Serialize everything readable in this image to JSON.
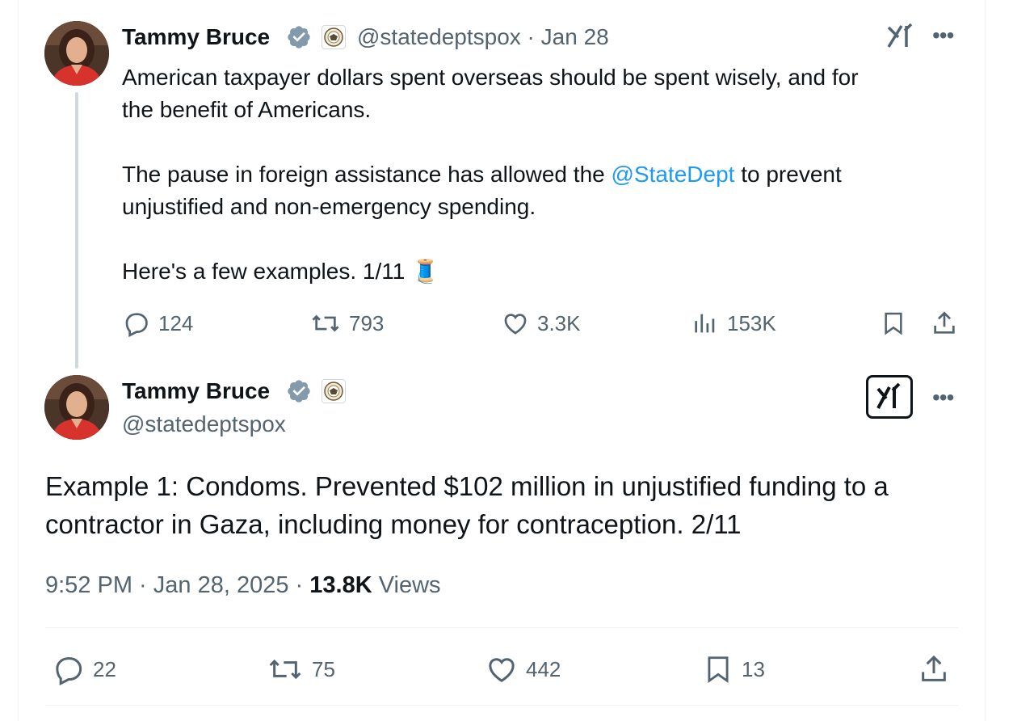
{
  "first_tweet": {
    "author_name": "Tammy Bruce",
    "handle": "@statedeptspox",
    "date": "Jan 28",
    "handle_date": "@statedeptspox · Jan 28",
    "line1": "American taxpayer dollars spent overseas should be spent wisely, and for",
    "line2": "the benefit of Americans.",
    "line3_pre": "The pause in foreign assistance has allowed the ",
    "line3_mention": "@StateDept",
    "line3_post": " to prevent",
    "line4": "unjustified and non-emergency spending.",
    "line5": "Here's a few examples. 1/11",
    "thread_emoji": "🧵",
    "replies": "124",
    "reposts": "793",
    "likes": "3.3K",
    "views": "153K"
  },
  "second_tweet": {
    "author_name": "Tammy Bruce",
    "handle": "@statedeptspox",
    "line1": "Example 1: Condoms. Prevented $102 million in unjustified funding to a",
    "line2": "contractor in Gaza, including money for contraception.  2/11",
    "meta_time": "9:52 PM · Jan 28, 2025 · ",
    "meta_views_count": "13.8K",
    "meta_views_label": " Views",
    "replies": "22",
    "reposts": "75",
    "likes": "442",
    "bookmarks": "13"
  },
  "icons": [
    "verified-badge-icon",
    "us-state-dept-seal-icon",
    "grok-icon",
    "more-icon",
    "reply-icon",
    "repost-icon",
    "like-icon",
    "views-icon",
    "bookmark-icon",
    "share-icon"
  ],
  "colors": {
    "accent": "#1d9bf0",
    "text": "#0f1419",
    "secondary": "#536471",
    "verified": "#829aab"
  }
}
